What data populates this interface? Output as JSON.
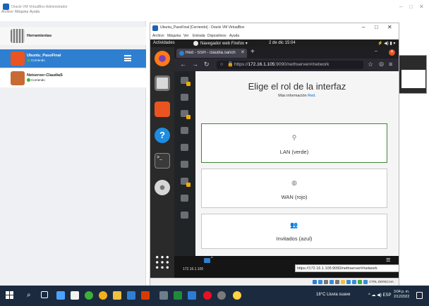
{
  "vbox_manager": {
    "title": "Oracle VM VirtualBox Administrador",
    "menu": [
      "Archivo",
      "Máquina",
      "Ayuda"
    ],
    "tools_label": "Herramientas",
    "vms": [
      {
        "name": "Ubuntu_PasoFinal",
        "state": "Corriendo"
      },
      {
        "name": "Netserver-ClaudiaS",
        "state": "Corriendo"
      }
    ]
  },
  "vm_window": {
    "title": "Ubuntu_PasoFinal [Corriendo] - Oracle VM VirtualBox",
    "menu": [
      "Archivo",
      "Máquina",
      "Ver",
      "Entrada",
      "Dispositivos",
      "Ayuda"
    ]
  },
  "gnome": {
    "activities": "Actividades",
    "app_menu": "Navegador web Firefox ▾",
    "clock": "2 de dic 15:04"
  },
  "firefox": {
    "tab_title": "Red - SSH - claudia.sanch",
    "url_prefix": "https://",
    "url_host": "172.16.1.105",
    "url_rest": ":9090/nethserver#/network"
  },
  "cockpit": {
    "heading": "Elige el rol de la interfaz",
    "more_info": "Más información",
    "more_info_link": "Red.",
    "roles": [
      {
        "label": "LAN (verde)",
        "icon": "network-icon"
      },
      {
        "label": "WAN (rojo)",
        "icon": "globe-icon"
      },
      {
        "label": "Invitados (azul)",
        "icon": "users-icon"
      }
    ]
  },
  "vm_bottom": {
    "ip": "172.16.1.105",
    "status_url": "https://172.16.1.105:9090/nethserver#/network",
    "host_key": "CTRL DERECHA"
  },
  "taskbar": {
    "weather": "18°C  Lluvia suave",
    "lang": "ESP",
    "time": "3:04 p. m.",
    "date": "2/12/2022"
  }
}
